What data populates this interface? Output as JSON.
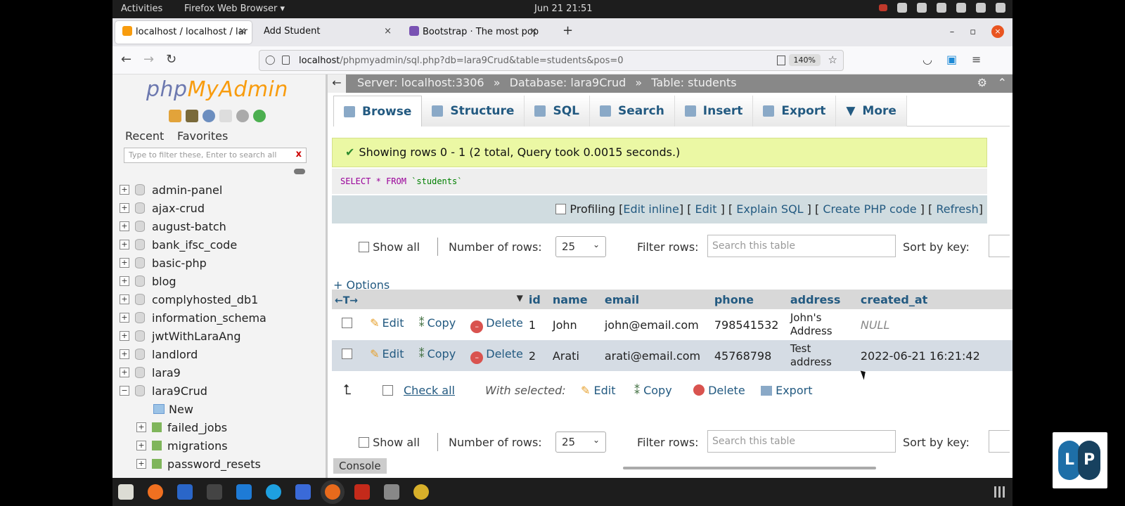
{
  "topbar": {
    "activities": "Activities",
    "app": "Firefox Web Browser ▾",
    "clock": "Jun 21  21:51"
  },
  "browser": {
    "tabs": [
      {
        "label": "localhost / localhost / lar",
        "close": "×"
      },
      {
        "label": "Add Student",
        "close": "×"
      },
      {
        "label": "Bootstrap · The most pop",
        "close": "×"
      }
    ],
    "new_tab": "+",
    "window_min": "–",
    "window_max": "▫",
    "window_close": "×",
    "url_host": "localhost",
    "url_path": "/phpmyadmin/sql.php?db=lara9Crud&table=students&pos=0",
    "zoom": "140%"
  },
  "sidebar": {
    "logo_php": "php",
    "logo_myadmin": "MyAdmin",
    "tab_recent": "Recent",
    "tab_favorites": "Favorites",
    "filter_placeholder": "Type to filter these, Enter to search all",
    "filter_clear": "x",
    "databases": [
      {
        "name": "admin-panel",
        "exp": "+"
      },
      {
        "name": "ajax-crud",
        "exp": "+"
      },
      {
        "name": "august-batch",
        "exp": "+"
      },
      {
        "name": "bank_ifsc_code",
        "exp": "+"
      },
      {
        "name": "basic-php",
        "exp": "+"
      },
      {
        "name": "blog",
        "exp": "+"
      },
      {
        "name": "complyhosted_db1",
        "exp": "+"
      },
      {
        "name": "information_schema",
        "exp": "+"
      },
      {
        "name": "jwtWithLaraAng",
        "exp": "+"
      },
      {
        "name": "landlord",
        "exp": "+"
      },
      {
        "name": "lara9",
        "exp": "+"
      },
      {
        "name": "lara9Crud",
        "exp": "−"
      }
    ],
    "tables": [
      {
        "name": "New"
      },
      {
        "name": "failed_jobs",
        "exp": "+"
      },
      {
        "name": "migrations",
        "exp": "+"
      },
      {
        "name": "password_resets",
        "exp": "+"
      }
    ]
  },
  "breadcrumb": {
    "server": "Server: localhost:3306",
    "database": "Database: lara9Crud",
    "table": "Table: students",
    "sep": "»"
  },
  "menu": [
    "Browse",
    "Structure",
    "SQL",
    "Search",
    "Insert",
    "Export",
    "More"
  ],
  "message": "Showing rows 0 - 1 (2 total, Query took 0.0015 seconds.)",
  "sql": {
    "select": "SELECT",
    "star": "*",
    "from": "FROM",
    "table": "`students`"
  },
  "profiling": {
    "label": "Profiling",
    "links": [
      "Edit inline",
      "Edit",
      "Explain SQL",
      "Create PHP code",
      "Refresh"
    ]
  },
  "nav": {
    "show_all": "Show all",
    "rows_label": "Number of rows:",
    "rows_value": "25",
    "filter_label": "Filter rows:",
    "filter_placeholder": "Search this table",
    "sort_label": "Sort by key:"
  },
  "options_link": "+ Options",
  "table": {
    "columns": [
      "id",
      "name",
      "email",
      "phone",
      "address",
      "created_at"
    ],
    "row_actions": {
      "edit": "Edit",
      "copy": "Copy",
      "delete": "Delete"
    },
    "rows": [
      {
        "id": "1",
        "name": "John",
        "email": "john@email.com",
        "phone": "798541532",
        "address": "John's Address",
        "created_at": "NULL"
      },
      {
        "id": "2",
        "name": "Arati",
        "email": "arati@email.com",
        "phone": "45768798",
        "address": "Test address",
        "created_at": "2022-06-21 16:21:42"
      }
    ]
  },
  "bulk": {
    "check_all": "Check all",
    "with_selected": "With selected:",
    "edit": "Edit",
    "copy": "Copy",
    "delete": "Delete",
    "export": "Export"
  },
  "console": "Console",
  "badge": {
    "l": "L",
    "p": "P"
  },
  "colors": {
    "accent": "#235a81",
    "success_bg": "#ebf8a4",
    "row_alt": "#d5dce4",
    "ubuntu_orange": "#e95420"
  }
}
